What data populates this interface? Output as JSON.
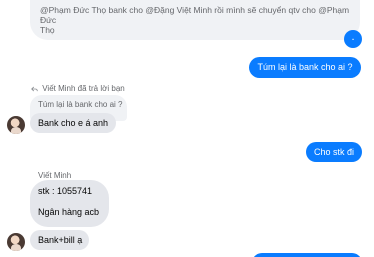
{
  "top_message": {
    "line1": "@Phạm Đức Thọ bank cho @Đặng Việt Minh rồi mình sẽ chuyển qtv cho @Phạm Đức",
    "line2": "Thọ"
  },
  "outgoing_dot": ".",
  "outgoing_question": "Túm lại là bank cho ai ?",
  "reply_header": "Viết Minh đã trả lời bạn",
  "quoted_text": "Túm lại là bank cho ai ?",
  "reply_message": "Bank cho e á anh",
  "outgoing_ask_stk": "Cho stk đi",
  "sender_name": "Viết Minh",
  "account_message": {
    "line1": "stk : 1055741",
    "line2": "",
    "line3": "Ngân hàng acb"
  },
  "last_message": "Bank+bill ạ",
  "colors": {
    "outgoing": "#0a7cff",
    "incoming": "#e4e6eb",
    "quote": "#f0f2f5",
    "meta_text": "#65676b"
  },
  "icons": [
    "reply-icon",
    "avatar"
  ]
}
